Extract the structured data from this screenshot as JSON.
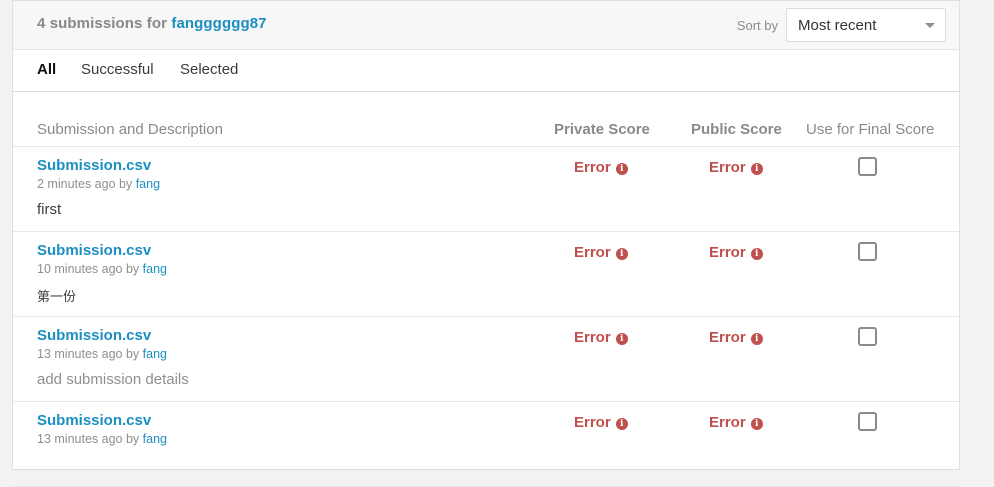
{
  "header": {
    "count_text": "4 submissions for",
    "username": "fangggggg87",
    "sort_label": "Sort by",
    "sort_value": "Most recent"
  },
  "tabs": [
    {
      "label": "All",
      "active": true
    },
    {
      "label": "Successful",
      "active": false
    },
    {
      "label": "Selected",
      "active": false
    }
  ],
  "columns": {
    "submission": "Submission and Description",
    "private": "Private Score",
    "public": "Public Score",
    "final": "Use for Final Score"
  },
  "rows": [
    {
      "file": "Submission.csv",
      "time": "2 minutes ago by",
      "user": "fang",
      "description": "first",
      "private": "Error",
      "public": "Error",
      "selected": false
    },
    {
      "file": "Submission.csv",
      "time": "10 minutes ago by",
      "user": "fang",
      "description": "第一份",
      "private": "Error",
      "public": "Error",
      "selected": false
    },
    {
      "file": "Submission.csv",
      "time": "13 minutes ago by",
      "user": "fang",
      "description": "add submission details",
      "private": "Error",
      "public": "Error",
      "selected": false
    },
    {
      "file": "Submission.csv",
      "time": "13 minutes ago by",
      "user": "fang",
      "description": "",
      "private": "Error",
      "public": "Error",
      "selected": false
    }
  ],
  "colors": {
    "accent": "#1c8fc2",
    "error": "#c0504d"
  },
  "icons": {
    "error_info": "info-circle-icon",
    "sort_caret": "caret-down-icon"
  }
}
